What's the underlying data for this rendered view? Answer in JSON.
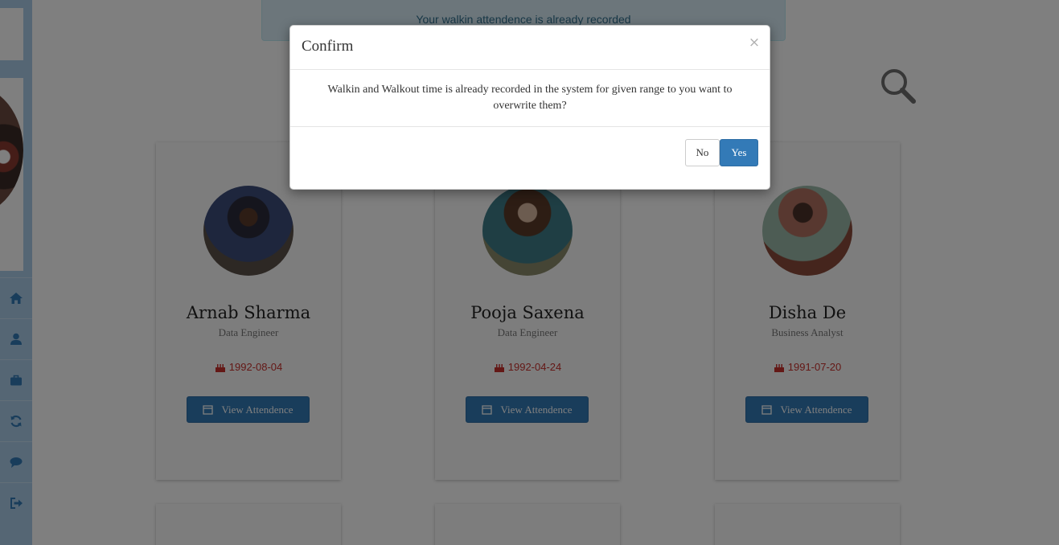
{
  "alert": {
    "text": "Your walkin attendence is already recorded"
  },
  "sidebar": {
    "items": [
      {
        "icon": "home-icon"
      },
      {
        "icon": "user-icon"
      },
      {
        "icon": "briefcase-icon"
      },
      {
        "icon": "refresh-icon"
      },
      {
        "icon": "comment-icon"
      },
      {
        "icon": "sign-out-icon"
      }
    ]
  },
  "employees": [
    {
      "name": "Arnab Sharma",
      "role": "Data Engineer",
      "dob": "1992-08-04",
      "button": "View Attendence"
    },
    {
      "name": "Pooja Saxena",
      "role": "Data Engineer",
      "dob": "1992-04-24",
      "button": "View Attendence"
    },
    {
      "name": "Disha De",
      "role": "Business Analyst",
      "dob": "1991-07-20",
      "button": "View Attendence"
    }
  ],
  "modal": {
    "title": "Confirm",
    "close": "×",
    "message": "Walkin and Walkout time is already recorded in the system for given range to you want to overwrite them?",
    "no_label": "No",
    "yes_label": "Yes"
  },
  "colors": {
    "primary": "#337ab7",
    "danger": "#c9302c",
    "sidebar": "#aacde9",
    "alert_bg": "#d9edf7",
    "alert_text": "#31708f"
  }
}
